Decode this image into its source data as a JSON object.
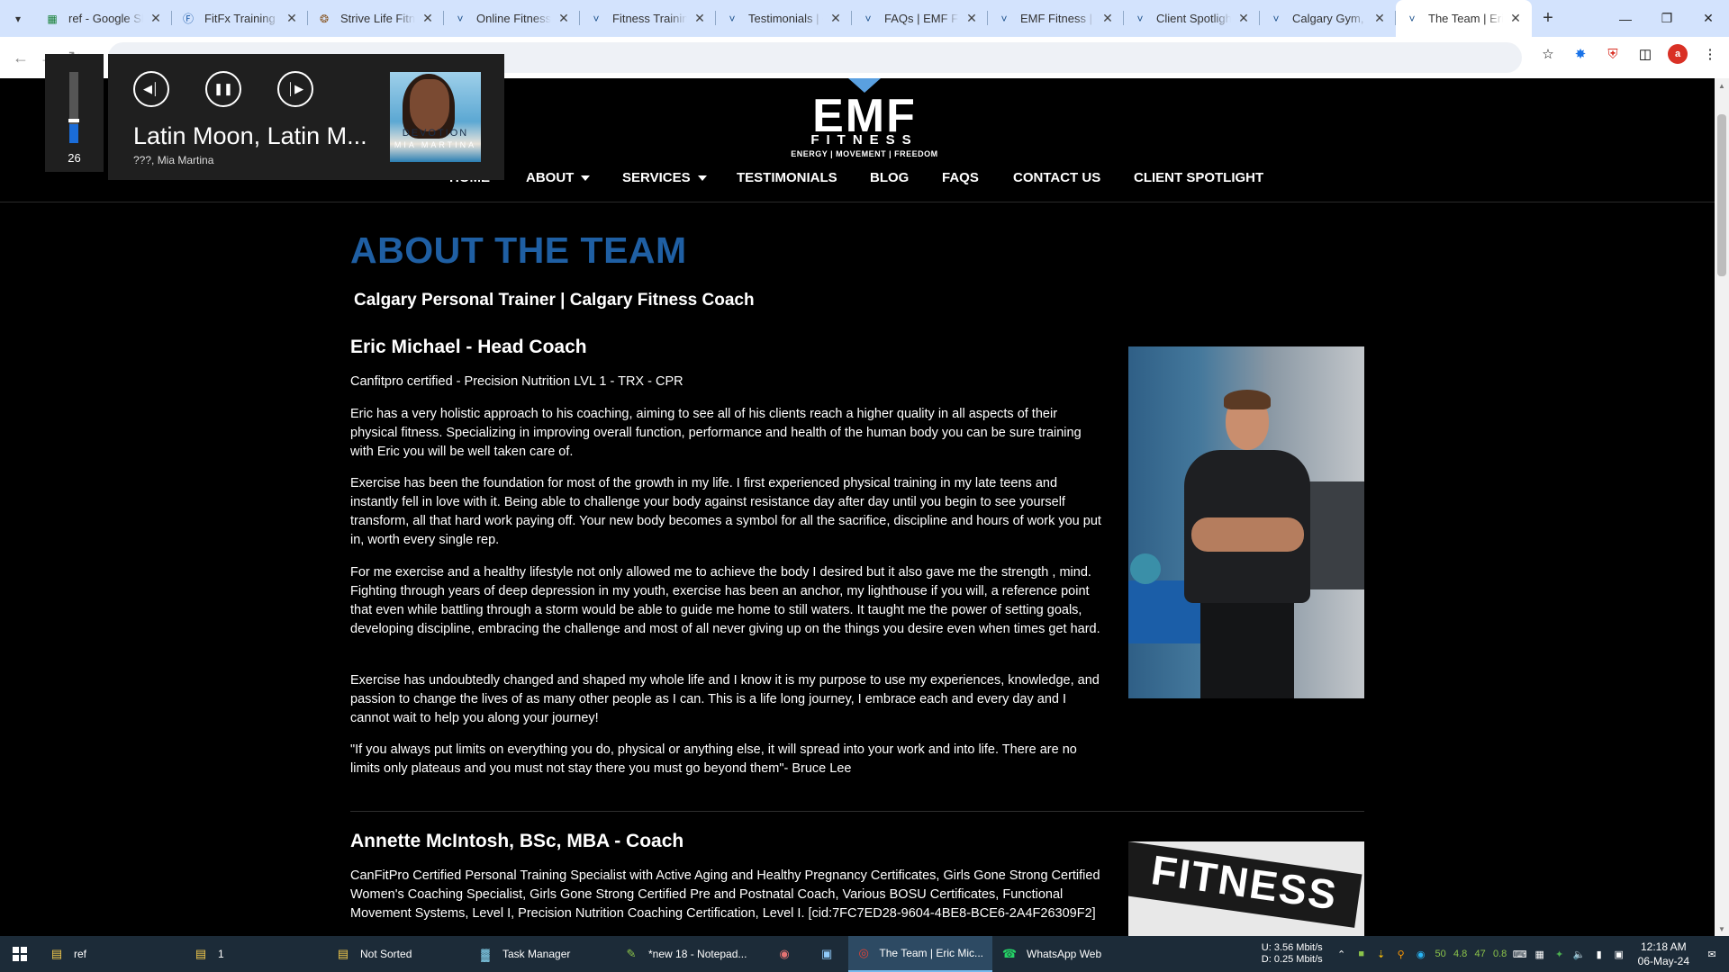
{
  "browser": {
    "tabs": [
      {
        "title": "ref - Google Sheets",
        "icon": "sheets-icon",
        "active": false
      },
      {
        "title": "FitFx Training | Personal",
        "icon": "fitfx-icon",
        "active": false
      },
      {
        "title": "Strive Life Fitness",
        "icon": "strive-icon",
        "active": false
      },
      {
        "title": "Online Fitness Coaching",
        "icon": "emf-icon",
        "active": false
      },
      {
        "title": "Fitness Training",
        "icon": "emf-icon",
        "active": false
      },
      {
        "title": "Testimonials | Calgary",
        "icon": "emf-icon",
        "active": false
      },
      {
        "title": "FAQs | EMF Fitness",
        "icon": "emf-icon",
        "active": false
      },
      {
        "title": "EMF Fitness | Calgary",
        "icon": "emf-icon",
        "active": false
      },
      {
        "title": "Client Spotlight",
        "icon": "emf-icon",
        "active": false
      },
      {
        "title": "Calgary Gym, Personal",
        "icon": "emf-icon",
        "active": false
      },
      {
        "title": "The Team | Eric",
        "icon": "emf-icon",
        "active": true
      }
    ],
    "new_tab_label": "+",
    "url": ""
  },
  "media": {
    "volume_level": 26,
    "volume_fraction": 0.26,
    "song": "Latin Moon, Latin M...",
    "artist": "???, Mia Martina",
    "album_title": "DEVOTION",
    "album_artist": "MIA MARTINA"
  },
  "site": {
    "logo_text": "EMF",
    "logo_sub": "FITNESS",
    "logo_tagline": "ENERGY | MOVEMENT | FREEDOM",
    "nav": [
      {
        "label": "HOME",
        "dropdown": false
      },
      {
        "label": "ABOUT",
        "dropdown": true
      },
      {
        "label": "SERVICES",
        "dropdown": true
      },
      {
        "label": "TESTIMONIALS",
        "dropdown": false
      },
      {
        "label": "BLOG",
        "dropdown": false
      },
      {
        "label": "FAQS",
        "dropdown": false
      },
      {
        "label": "CONTACT US",
        "dropdown": false
      },
      {
        "label": "CLIENT SPOTLIGHT",
        "dropdown": false
      }
    ]
  },
  "page": {
    "heading": "ABOUT THE TEAM",
    "subheading": "Calgary Personal Trainer | Calgary Fitness Coach",
    "coaches": [
      {
        "name": "Eric Michael - Head Coach",
        "certifications": "Canfitpro certified - Precision Nutrition LVL 1 - TRX - CPR",
        "paragraphs": [
          "Eric has a very holistic approach to his coaching, aiming to see all of his clients reach a higher quality in all aspects of their physical fitness. Specializing in improving overall function, performance and health of the human body you can be sure training with Eric you will be well taken care of.",
          "Exercise has been the foundation for most of the growth in my life. I first experienced physical training in my late teens and instantly fell in love with it. Being able to challenge your body against resistance day after day until you begin to see yourself transform, all that hard work paying off. Your new body becomes a symbol for all the sacrifice, discipline and hours of work you put in, worth every single rep.",
          "For me exercise and a healthy lifestyle not only allowed me to achieve the body I desired but it also gave me the strength , mind. Fighting through years of deep depression in my youth, exercise has been an anchor, my lighthouse if you will, a reference point that even while battling through a storm would be able to guide me home to still waters. It taught me the power of setting goals, developing discipline, embracing the challenge and most of all never giving up on the things you desire even when times get hard.",
          "Exercise has undoubtedly changed and shaped my whole life and I know it is my purpose to use my experiences, knowledge, and passion to change the lives of as many other people as I can. This is a life long journey, I embrace each and every day and I cannot wait to help you along your journey!",
          "\"If you always put limits on everything you do, physical or anything else, it will spread into your work and into life. There are no limits only plateaus and you must not stay there you must go beyond them\"- Bruce Lee"
        ]
      },
      {
        "name": "Annette McIntosh, BSc, MBA - Coach",
        "certifications": "CanFitPro Certified Personal Training Specialist with Active Aging and Healthy Pregnancy Certificates, Girls Gone Strong Certified Women's Coaching Specialist, Girls Gone Strong Certified Pre and Postnatal Coach, Various BOSU Certificates, Functional Movement Systems, Level I, Precision Nutrition Coaching Certification, Level I. [cid:7FC7ED28-9604-4BE8-BCE6-2A4F26309F2]"
      }
    ],
    "photo2_sign": "FITNESS"
  },
  "taskbar": {
    "items": [
      {
        "label": "ref",
        "icon": "folder-icon"
      },
      {
        "label": "1",
        "icon": "folder-icon"
      },
      {
        "label": "Not Sorted",
        "icon": "folder-icon"
      },
      {
        "label": "Task Manager",
        "icon": "task-manager-icon"
      },
      {
        "label": "*new 18 - Notepad...",
        "icon": "notepad-icon"
      },
      {
        "label": "",
        "icon": "app-icon"
      },
      {
        "label": "",
        "icon": "calculator-icon"
      },
      {
        "label": "The Team | Eric Mic...",
        "icon": "chrome-icon"
      },
      {
        "label": "WhatsApp Web",
        "icon": "whatsapp-icon"
      }
    ],
    "net_up": "U:  3.56 Mbit/s",
    "net_down": "D:  0.25 Mbit/s",
    "tray_values": [
      "50",
      "4.8",
      "47",
      "0.8"
    ],
    "time": "12:18 AM",
    "date": "06-May-24"
  }
}
